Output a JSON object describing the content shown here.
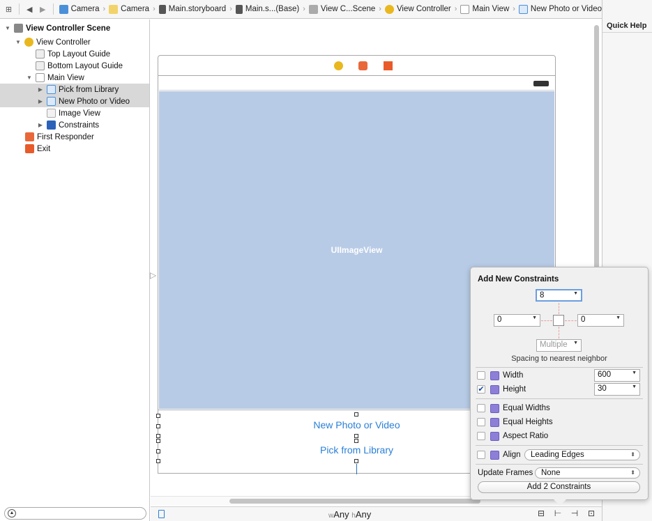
{
  "jumpbar": {
    "crumbs": [
      {
        "label": "Camera",
        "icon": "project-icon"
      },
      {
        "label": "Camera",
        "icon": "folder-icon"
      },
      {
        "label": "Main.storyboard",
        "icon": "storyboard-icon"
      },
      {
        "label": "Main.s...(Base)",
        "icon": "storyboard-icon"
      },
      {
        "label": "View C...Scene",
        "icon": "scene-icon"
      },
      {
        "label": "View Controller",
        "icon": "view-controller-icon"
      },
      {
        "label": "Main View",
        "icon": "view-icon"
      },
      {
        "label": "New Photo or Video",
        "icon": "button-icon"
      }
    ]
  },
  "quick_help": {
    "title": "Quick Help"
  },
  "outline": {
    "items": [
      {
        "label": "View Controller Scene",
        "depth": 0,
        "expanded": true,
        "bold": true,
        "icon": "scene-icon"
      },
      {
        "label": "View Controller",
        "depth": 1,
        "expanded": true,
        "icon": "view-controller-icon"
      },
      {
        "label": "Top Layout Guide",
        "depth": 2,
        "icon": "layout-guide-icon"
      },
      {
        "label": "Bottom Layout Guide",
        "depth": 2,
        "icon": "layout-guide-icon"
      },
      {
        "label": "Main View",
        "depth": 2,
        "expanded": true,
        "icon": "view-icon"
      },
      {
        "label": "Pick from Library",
        "depth": 3,
        "expanded": false,
        "selected": true,
        "icon": "button-icon"
      },
      {
        "label": "New Photo or Video",
        "depth": 3,
        "expanded": false,
        "selected": true,
        "icon": "button-icon"
      },
      {
        "label": "Image View",
        "depth": 3,
        "icon": "image-view-icon"
      },
      {
        "label": "Constraints",
        "depth": 3,
        "expanded": false,
        "icon": "constraints-icon"
      },
      {
        "label": "First Responder",
        "depth": 1,
        "icon": "first-responder-icon"
      },
      {
        "label": "Exit",
        "depth": 1,
        "icon": "exit-icon"
      }
    ],
    "filter_placeholder": ""
  },
  "canvas": {
    "image_view_label": "UIImageView",
    "buttons": [
      "New Photo or Video",
      "Pick from Library"
    ],
    "size_class": {
      "w_prefix": "w",
      "w_value": "Any",
      "h_prefix": "h",
      "h_value": "Any"
    }
  },
  "popover": {
    "title": "Add New Constraints",
    "top": "8",
    "left": "0",
    "right": "0",
    "bottom": "Multiple",
    "spacing_label": "Spacing to nearest neighbor",
    "width": {
      "label": "Width",
      "value": "600",
      "checked": false
    },
    "height": {
      "label": "Height",
      "value": "30",
      "checked": true
    },
    "equal_widths": {
      "label": "Equal Widths",
      "checked": false
    },
    "equal_heights": {
      "label": "Equal Heights",
      "checked": false
    },
    "aspect_ratio": {
      "label": "Aspect Ratio",
      "checked": false
    },
    "align": {
      "label": "Align",
      "value": "Leading Edges",
      "checked": false
    },
    "update_frames": {
      "label": "Update Frames",
      "value": "None"
    },
    "add_button": "Add 2 Constraints"
  },
  "colors": {
    "accent_blue": "#2a7fd6",
    "image_view_fill": "#b8cbe6",
    "selection_gray": "#d8d8d8",
    "constraint_icon_purple": "#8d7fd8"
  }
}
